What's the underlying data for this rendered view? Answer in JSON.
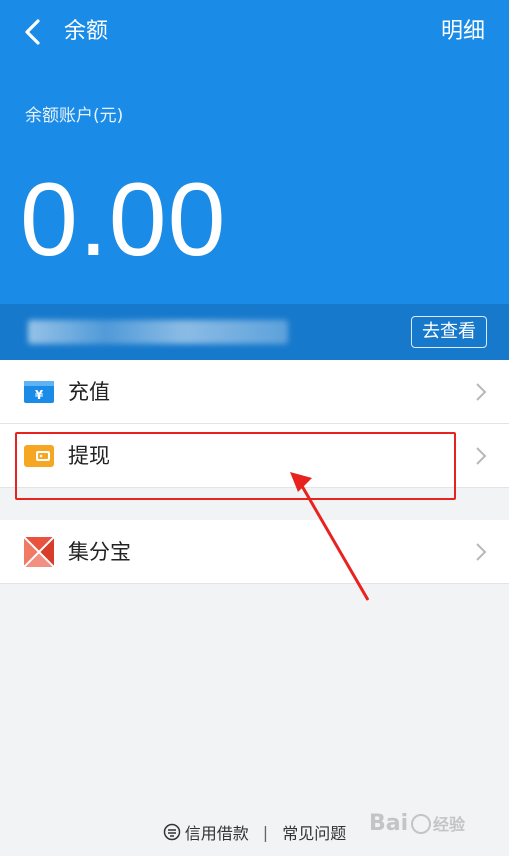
{
  "header": {
    "title": "余额",
    "detail_link": "明细",
    "account_label": "余额账户(元)",
    "balance": "0.00",
    "background_color": "#1a8be6"
  },
  "notice": {
    "view_button": "去查看"
  },
  "menu": {
    "group1": [
      {
        "label": "充值",
        "icon": "recharge-icon",
        "icon_color": "#1a8be6"
      },
      {
        "label": "提现",
        "icon": "wallet-icon",
        "icon_color": "#f5a623"
      }
    ],
    "group2": [
      {
        "label": "集分宝",
        "icon": "jifenbao-icon",
        "icon_color": "#e8533f"
      }
    ]
  },
  "footer": {
    "credit_loan": "信用借款",
    "faq": "常见问题"
  },
  "annotation": {
    "highlight_color": "#e8231f"
  }
}
